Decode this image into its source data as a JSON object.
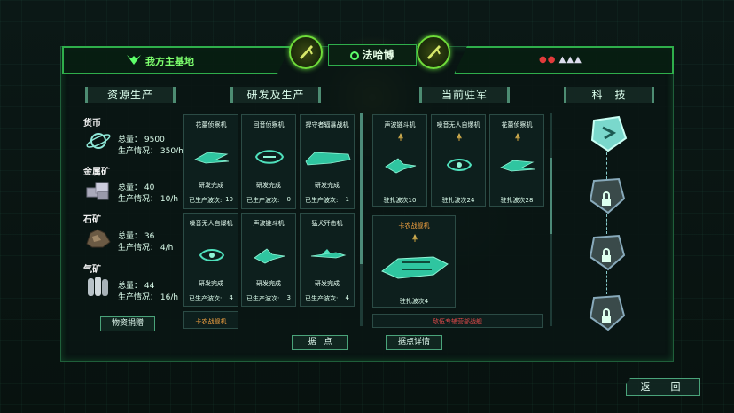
{
  "header": {
    "home_base": "我方主基地",
    "enemy_name": "法哈博",
    "threat_colors": {
      "red": "#e23b3b",
      "white": "#dddde8"
    }
  },
  "sections": {
    "resources": "资源生产",
    "research": "研发及生产",
    "garrison": "当前驻军",
    "tech": "科　技"
  },
  "resources": [
    {
      "name": "货币",
      "icon": "planet-icon",
      "total_label": "总量：",
      "total": "9500",
      "rate_label": "生产情况：",
      "rate": "350/h"
    },
    {
      "name": "金属矿",
      "icon": "metal-ore-icon",
      "total_label": "总量：",
      "total": "40",
      "rate_label": "生产情况：",
      "rate": "10/h"
    },
    {
      "name": "石矿",
      "icon": "stone-ore-icon",
      "total_label": "总量：",
      "total": "36",
      "rate_label": "生产情况：",
      "rate": "4/h"
    },
    {
      "name": "气矿",
      "icon": "gas-canister-icon",
      "total_label": "总量：",
      "total": "44",
      "rate_label": "生产情况：",
      "rate": "16/h"
    }
  ],
  "donate_button": "物资捐赠",
  "research_cards": [
    {
      "name": "花蕾侦察机",
      "status": "研发完成",
      "wave_label": "已生产波次:",
      "wave": "10"
    },
    {
      "name": "回音侦察机",
      "status": "研发完成",
      "wave_label": "已生产波次:",
      "wave": "0"
    },
    {
      "name": "捍守者辐暴战机",
      "status": "研发完成",
      "wave_label": "已生产波次:",
      "wave": "1"
    },
    {
      "name": "噪音无人自爆机",
      "status": "研发完成",
      "wave_label": "已生产波次:",
      "wave": "4"
    },
    {
      "name": "声波链斗机",
      "status": "研发完成",
      "wave_label": "已生产波次:",
      "wave": "3"
    },
    {
      "name": "猛犬歼击机",
      "status": "研发完成",
      "wave_label": "已生产波次:",
      "wave": "4"
    }
  ],
  "research_partial": "卡农战舰机",
  "garrison_cards": [
    {
      "name": "声波链斗机",
      "wave": "驻扎波次10"
    },
    {
      "name": "噪音无人自爆机",
      "wave": "驻扎波次24"
    },
    {
      "name": "花蕾侦察机",
      "wave": "驻扎波次28"
    }
  ],
  "garrison_big": {
    "name": "卡农战舰机",
    "wave": "驻扎波次4"
  },
  "garrison_partial": "敌伍专辅营部战舰",
  "buttons": {
    "outpost": "据　点",
    "outpost_detail": "据点详情",
    "back": "返　回"
  },
  "tech_nodes": [
    {
      "id": "tech-1",
      "locked": false
    },
    {
      "id": "tech-2",
      "locked": true
    },
    {
      "id": "tech-3",
      "locked": true
    },
    {
      "id": "tech-4",
      "locked": true
    }
  ]
}
